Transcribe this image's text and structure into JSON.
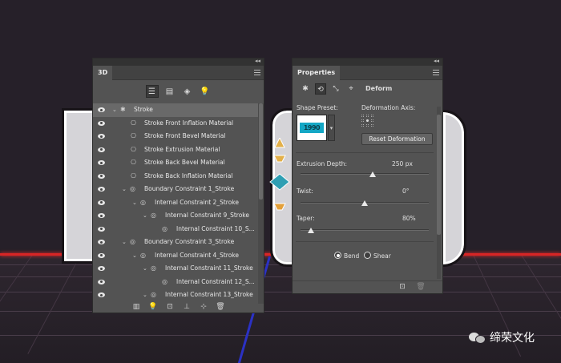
{
  "panel3d": {
    "tab_label": "3D",
    "collapse_glyph": "◂◂",
    "filter_icons": [
      "scene-filter-icon",
      "mesh-filter-icon",
      "material-filter-icon",
      "light-filter-icon"
    ],
    "rows": [
      {
        "label": "Stroke",
        "visible": true,
        "selected": true
      },
      {
        "label": "Stroke Front Inflation Material",
        "visible": true
      },
      {
        "label": "Stroke Front Bevel Material",
        "visible": true
      },
      {
        "label": "Stroke Extrusion Material",
        "visible": true
      },
      {
        "label": "Stroke Back Bevel Material",
        "visible": true
      },
      {
        "label": "Stroke Back Inflation Material",
        "visible": true
      },
      {
        "label": "Boundary Constraint 1_Stroke",
        "visible": true
      },
      {
        "label": "Internal Constraint 2_Stroke",
        "visible": true
      },
      {
        "label": "Internal Constraint 9_Stroke",
        "visible": true
      },
      {
        "label": "Internal Constraint 10_S...",
        "visible": true
      },
      {
        "label": "Boundary Constraint 3_Stroke",
        "visible": true
      },
      {
        "label": "Internal Constraint 4_Stroke",
        "visible": true
      },
      {
        "label": "Internal Constraint 11_Stroke",
        "visible": true
      },
      {
        "label": "Internal Constraint 12_S...",
        "visible": true
      },
      {
        "label": "Internal Constraint 13_Stroke",
        "visible": true
      }
    ]
  },
  "properties": {
    "tab_label": "Properties",
    "collapse_glyph": "◂◂",
    "mode_label": "Deform",
    "shape_preset_label": "Shape Preset:",
    "preset_thumbnail_text": "1990",
    "deformation_axis_label": "Deformation Axis:",
    "reset_button": "Reset Deformation",
    "extrusion_depth": {
      "label": "Extrusion Depth:",
      "value": "250 px",
      "fraction": 0.56
    },
    "twist": {
      "label": "Twist:",
      "value": "0°",
      "fraction": 0.5
    },
    "taper": {
      "label": "Taper:",
      "value": "80%",
      "fraction": 0.08
    },
    "bend_label": "Bend",
    "shear_label": "Shear",
    "bend_selected": true
  },
  "watermark": {
    "text": "缔荣文化"
  },
  "colors": {
    "panel": "#535353",
    "background": "#262029",
    "accent_red": "#d82525",
    "preset_cyan": "#14a7c5"
  }
}
